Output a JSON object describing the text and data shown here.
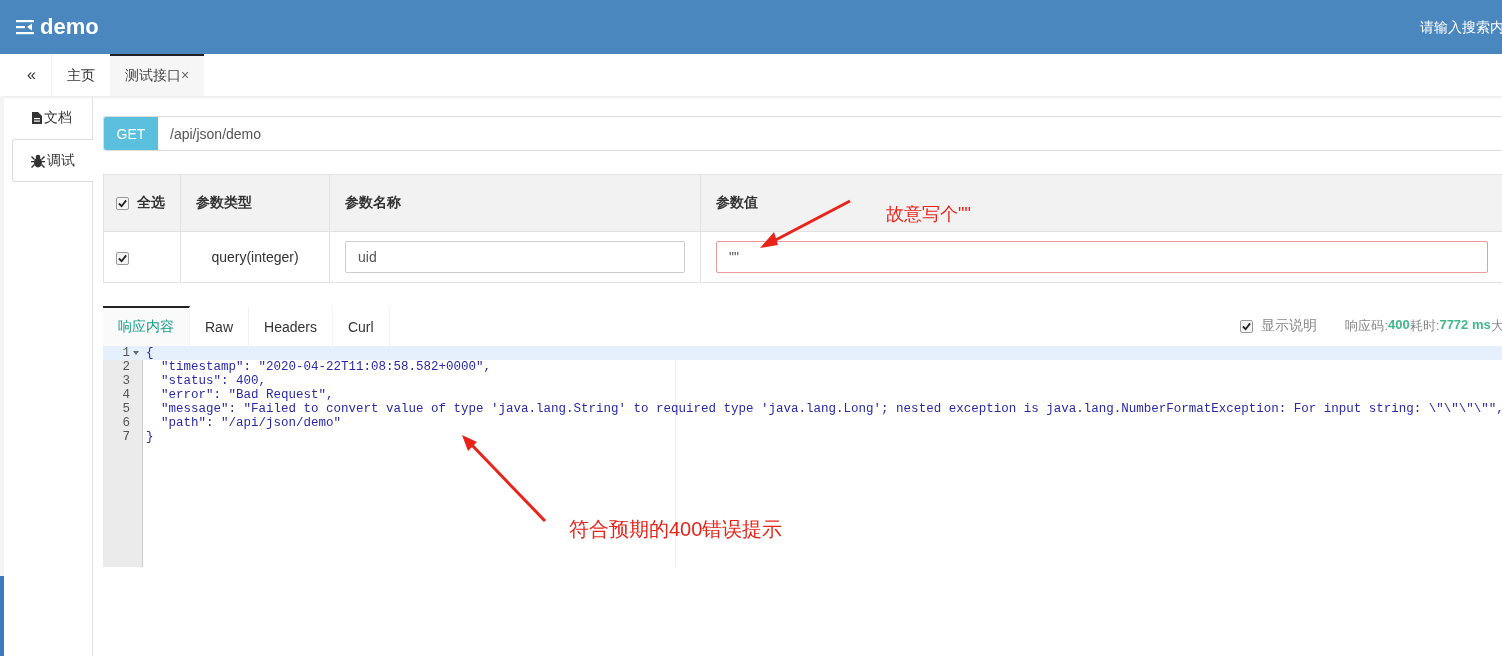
{
  "header": {
    "title": "demo",
    "search": {
      "placeholder": "请输入搜索内"
    }
  },
  "tabbar": {
    "collapse": "«",
    "tabs": [
      {
        "label": "主页",
        "selected": false
      },
      {
        "label": "测试接口",
        "close": "×",
        "selected": true
      }
    ]
  },
  "side_tabs": [
    {
      "label": "文档",
      "kind": "docs",
      "selected": false
    },
    {
      "label": "调试",
      "kind": "debug",
      "selected": true
    }
  ],
  "request": {
    "method": "GET",
    "url": "/api/json/demo"
  },
  "params": {
    "select_all": {
      "label": "全选",
      "checked": true
    },
    "columns": [
      "参数类型",
      "参数名称",
      "参数值"
    ],
    "rows": [
      {
        "checked": true,
        "type": "query(integer)",
        "name": "uid",
        "value": "\"\"",
        "invalid": true
      }
    ]
  },
  "response": {
    "tabs": [
      {
        "label": "响应内容",
        "selected": true
      },
      {
        "label": "Raw",
        "selected": false
      },
      {
        "label": "Headers",
        "selected": false
      },
      {
        "label": "Curl",
        "selected": false
      }
    ],
    "show_notes": {
      "label": "显示说明",
      "checked": true
    },
    "status": [
      {
        "text": "响应码:",
        "kind": "label"
      },
      {
        "text": "400",
        "kind": "value"
      },
      {
        "text": "耗时:",
        "kind": "label"
      },
      {
        "text": "7772 ms",
        "kind": "value"
      },
      {
        "text": "大",
        "kind": "label"
      }
    ]
  },
  "code": {
    "lines": [
      {
        "number": "1",
        "text": "{",
        "fold": true,
        "active": true
      },
      {
        "number": "2",
        "text": "  \"timestamp\": \"2020-04-22T11:08:58.582+0000\",",
        "fold": false,
        "active": false
      },
      {
        "number": "3",
        "text": "  \"status\": 400,",
        "fold": false,
        "active": false
      },
      {
        "number": "4",
        "text": "  \"error\": \"Bad Request\",",
        "fold": false,
        "active": false
      },
      {
        "number": "5",
        "text": "  \"message\": \"Failed to convert value of type 'java.lang.String' to required type 'java.lang.Long'; nested exception is java.lang.NumberFormatException: For input string: \\\"\\\"\\\"\\\"\",",
        "fold": false,
        "active": false
      },
      {
        "number": "6",
        "text": "  \"path\": \"/api/json/demo\"",
        "fold": false,
        "active": false
      },
      {
        "number": "7",
        "text": "}",
        "fold": false,
        "active": false
      }
    ]
  },
  "annotations": [
    {
      "text": "故意写个\"\""
    },
    {
      "text": "符合预期的400错误提示"
    }
  ]
}
